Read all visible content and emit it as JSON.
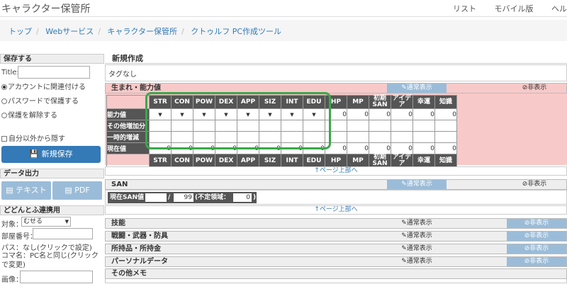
{
  "app": {
    "title": "キャラクター保管所"
  },
  "nav": [
    "リスト",
    "モバイル版",
    "ヘル"
  ],
  "breadcrumb": [
    "トップ",
    "Webサービス",
    "キャラクター保管所",
    "クトゥルフ PC作成ツール"
  ],
  "sidebar": {
    "save_head": "保存する",
    "title_label": "Title:",
    "radio1": "アカウントに関連付ける",
    "radio2": "パスワードで保護する",
    "radio3": "保護を解除する",
    "check": "自分以外から隠す",
    "save_button": "新規保存",
    "export_head": "データ出力",
    "text_button": "テキスト",
    "pdf_button": "PDF",
    "dodon_head": "どどんとふ連携用",
    "target_label": "対象：",
    "target_value": "むせる",
    "room_label": "部屋番号：",
    "pass_text": "パス：なし(クリックで設定)",
    "koma_text": "コマ名：PC名と同じ(クリックで変更)",
    "image_label": "画像："
  },
  "main": {
    "title": "新規作成",
    "tags": "タグなし",
    "status_section": "生まれ・能力値",
    "normal_view": "通常表示",
    "hide": "非表示",
    "page_top": "↑ページ上部へ",
    "san_section": "SAN",
    "san_label": "現在SAN値",
    "san_max": "99",
    "san_indef": "(不定領域：",
    "san_indef_val": "0",
    "skills": "技能",
    "combat": "戦闘・武器・防具",
    "items": "所持品・所持金",
    "personal": "パーソナルデータ",
    "memo": "その他メモ"
  },
  "stats": {
    "headers": [
      "STR",
      "CON",
      "POW",
      "DEX",
      "APP",
      "SIZ",
      "INT",
      "EDU",
      "HP",
      "MP",
      "初期SAN",
      "アイデア",
      "幸運",
      "知識"
    ],
    "rows": [
      "能力値",
      "その他増加分",
      "一時的増減",
      "現在値"
    ],
    "base": [
      "0",
      "0",
      "0",
      "0",
      "0",
      "0"
    ],
    "current": [
      "0",
      "0",
      "0",
      "0",
      "0",
      "0",
      "0",
      "0",
      "0",
      "0",
      "0",
      "0",
      "0",
      "0"
    ]
  },
  "colors": {
    "accent": "#337ab7",
    "pink": "#f8c9c9",
    "highlight": "#3aa84a"
  }
}
